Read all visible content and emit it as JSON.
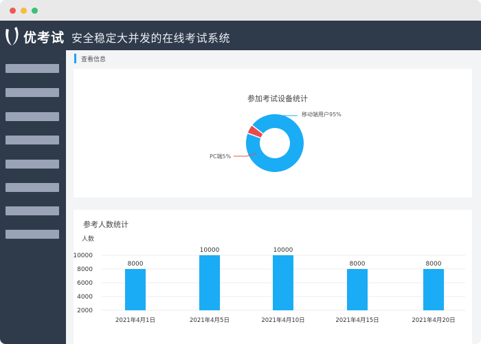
{
  "app": {
    "logo_text": "优考试",
    "system_title": "安全稳定大并发的在线考试系统"
  },
  "sidebar": {
    "items": [
      {
        "label": ""
      },
      {
        "label": ""
      },
      {
        "label": ""
      },
      {
        "label": ""
      },
      {
        "label": ""
      },
      {
        "label": ""
      },
      {
        "label": ""
      },
      {
        "label": ""
      }
    ]
  },
  "breadcrumb": {
    "label": "查看信息"
  },
  "colors": {
    "accent": "#1fa2f0",
    "bar": "#1aacf5",
    "pie_mobile": "#1aacf5",
    "pie_pc": "#e94b4b",
    "header_bg": "#2f3a4a"
  },
  "chart_data": [
    {
      "type": "pie",
      "title": "参加考试设备统计",
      "style": "donut",
      "slices": [
        {
          "name": "移动端用户",
          "value": 95,
          "label": "移动端用户95%"
        },
        {
          "name": "PC端",
          "value": 5,
          "label": "PC端5%"
        }
      ]
    },
    {
      "type": "bar",
      "title": "参考人数统计",
      "ylabel": "人数",
      "categories": [
        "2021年4月1日",
        "2021年4月5日",
        "2021年4月10日",
        "2021年4月15日",
        "2021年4月20日"
      ],
      "values": [
        8000,
        10000,
        10000,
        8000,
        8000
      ],
      "data_labels": [
        "8000",
        "10000",
        "10000",
        "8000",
        "8000"
      ],
      "yticks": [
        "2000",
        "4000",
        "6000",
        "8000",
        "10000"
      ],
      "ylim": [
        2000,
        10000
      ],
      "grid": true
    }
  ]
}
